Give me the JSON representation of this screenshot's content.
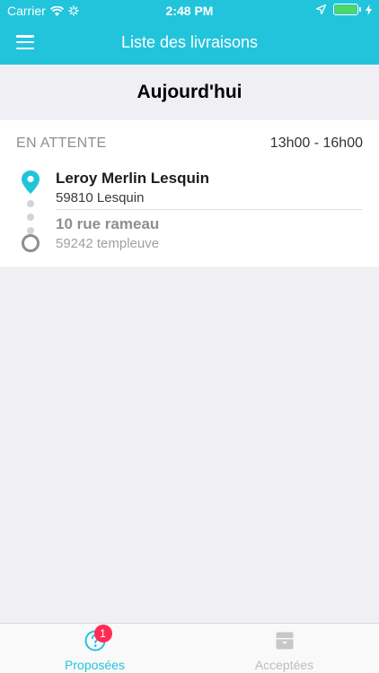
{
  "status_bar": {
    "carrier": "Carrier",
    "time": "2:48 PM"
  },
  "nav": {
    "title": "Liste des livraisons"
  },
  "section": {
    "title": "Aujourd'hui"
  },
  "delivery": {
    "status": "EN ATTENTE",
    "time_range": "13h00 - 16h00",
    "pickup": {
      "name": "Leroy Merlin Lesquin",
      "address": "59810 Lesquin"
    },
    "dropoff": {
      "name": "10 rue rameau",
      "address": "59242 templeuve"
    }
  },
  "tabs": [
    {
      "label": "Proposées",
      "icon": "question-circle-icon",
      "badge": "1",
      "active": true
    },
    {
      "label": "Acceptées",
      "icon": "archive-box-icon",
      "active": false
    }
  ],
  "colors": {
    "accent": "#22c4dc",
    "badge": "#ff2d55",
    "battery": "#4cd964"
  }
}
